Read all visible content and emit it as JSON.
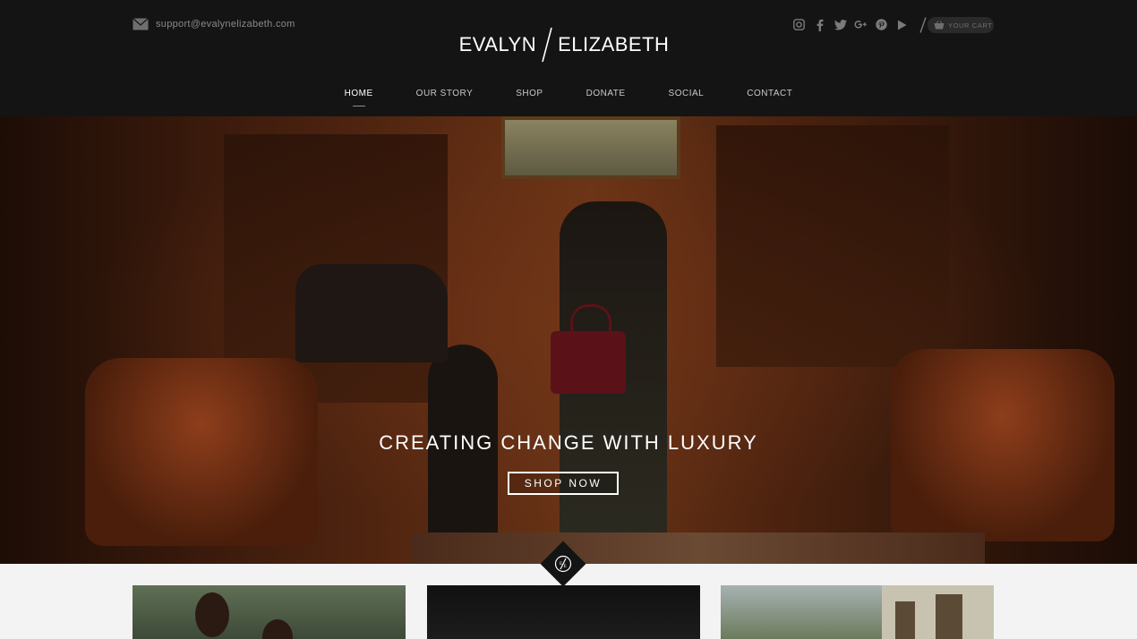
{
  "header": {
    "email": "support@evalynelizabeth.com",
    "logo_left": "EVALYN",
    "logo_right": "ELIZABETH",
    "social_icons": [
      "instagram-icon",
      "facebook-icon",
      "twitter-icon",
      "google-plus-icon",
      "pinterest-icon",
      "youtube-icon",
      "slash-icon"
    ],
    "cart_label": "YOUR CART"
  },
  "nav": {
    "items": [
      {
        "label": "HOME",
        "active": true
      },
      {
        "label": "OUR STORY",
        "active": false
      },
      {
        "label": "SHOP",
        "active": false
      },
      {
        "label": "DONATE",
        "active": false
      },
      {
        "label": "SOCIAL",
        "active": false
      },
      {
        "label": "CONTACT",
        "active": false
      }
    ]
  },
  "hero": {
    "title": "CREATING CHANGE WITH LUXURY",
    "button": "SHOP NOW"
  },
  "colors": {
    "header_bg": "#141414",
    "nav_text": "#c9c9c9",
    "accent_white": "#ffffff"
  }
}
